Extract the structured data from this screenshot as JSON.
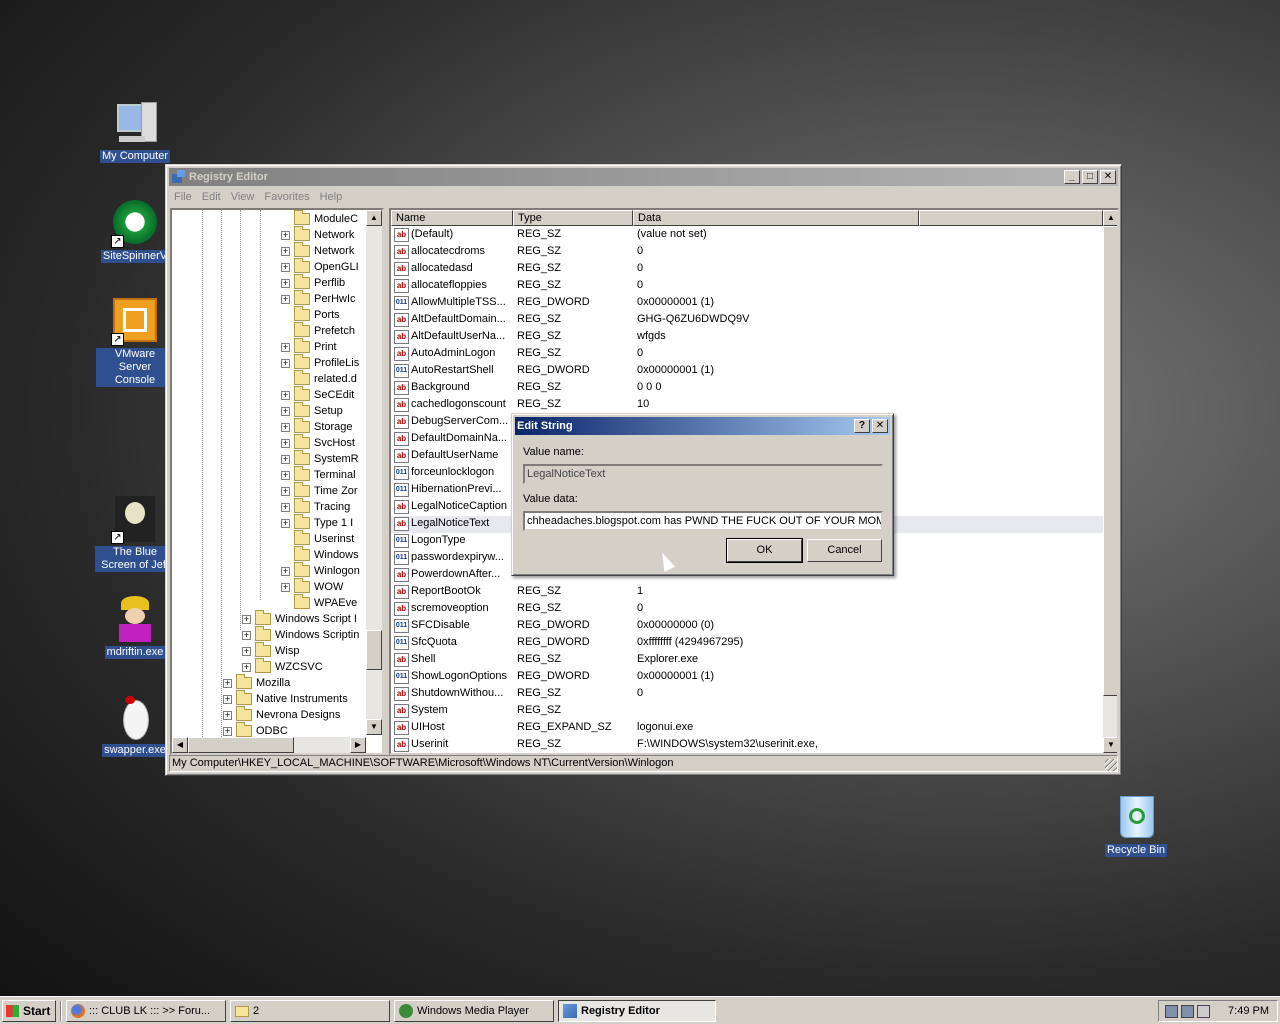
{
  "desktop": {
    "icons": [
      {
        "label": "My Computer",
        "icon": "computer-icon"
      },
      {
        "label": "SiteSpinnerV",
        "icon": "sitespinner-icon"
      },
      {
        "label": "VMware Server Console",
        "icon": "vmware-icon"
      },
      {
        "label": "The Blue Screen of Jeff",
        "icon": "skull-icon"
      },
      {
        "label": "mdriftin.exe",
        "icon": "jester-icon"
      },
      {
        "label": "swapper.exe",
        "icon": "mouse-icon"
      },
      {
        "label": "Recycle Bin",
        "icon": "recycle-bin-icon"
      }
    ]
  },
  "window": {
    "title": "Registry Editor",
    "menu": [
      "File",
      "Edit",
      "View",
      "Favorites",
      "Help"
    ],
    "tree": [
      {
        "label": "ModuleC",
        "expander": "",
        "level": 3
      },
      {
        "label": "Network",
        "expander": "+",
        "level": 3
      },
      {
        "label": "Network",
        "expander": "+",
        "level": 3
      },
      {
        "label": "OpenGLI",
        "expander": "+",
        "level": 3
      },
      {
        "label": "Perflib",
        "expander": "+",
        "level": 3
      },
      {
        "label": "PerHwIc",
        "expander": "+",
        "level": 3
      },
      {
        "label": "Ports",
        "expander": "",
        "level": 3
      },
      {
        "label": "Prefetch",
        "expander": "",
        "level": 3
      },
      {
        "label": "Print",
        "expander": "+",
        "level": 3
      },
      {
        "label": "ProfileLis",
        "expander": "+",
        "level": 3
      },
      {
        "label": "related.d",
        "expander": "",
        "level": 3
      },
      {
        "label": "SeCEdit",
        "expander": "+",
        "level": 3
      },
      {
        "label": "Setup",
        "expander": "+",
        "level": 3
      },
      {
        "label": "Storage",
        "expander": "+",
        "level": 3
      },
      {
        "label": "SvcHost",
        "expander": "+",
        "level": 3
      },
      {
        "label": "SystemR",
        "expander": "+",
        "level": 3
      },
      {
        "label": "Terminal",
        "expander": "+",
        "level": 3
      },
      {
        "label": "Time Zor",
        "expander": "+",
        "level": 3
      },
      {
        "label": "Tracing",
        "expander": "+",
        "level": 3
      },
      {
        "label": "Type 1 I",
        "expander": "+",
        "level": 3
      },
      {
        "label": "Userinst",
        "expander": "",
        "level": 3
      },
      {
        "label": "Windows",
        "expander": "",
        "level": 3
      },
      {
        "label": "Winlogon",
        "expander": "+",
        "level": 3
      },
      {
        "label": "WOW",
        "expander": "+",
        "level": 3
      },
      {
        "label": "WPAEve",
        "expander": "",
        "level": 3
      },
      {
        "label": "Windows Script I",
        "expander": "+",
        "level": 2
      },
      {
        "label": "Windows Scriptin",
        "expander": "+",
        "level": 2
      },
      {
        "label": "Wisp",
        "expander": "+",
        "level": 2
      },
      {
        "label": "WZCSVC",
        "expander": "+",
        "level": 2
      },
      {
        "label": "Mozilla",
        "expander": "+",
        "level": 1
      },
      {
        "label": "Native Instruments",
        "expander": "+",
        "level": 1
      },
      {
        "label": "Nevrona Designs",
        "expander": "+",
        "level": 1
      },
      {
        "label": "ODBC",
        "expander": "+",
        "level": 1
      }
    ],
    "columns": [
      "Name",
      "Type",
      "Data"
    ],
    "values": [
      {
        "name": "(Default)",
        "type": "REG_SZ",
        "data": "(value not set)",
        "kind": "ab"
      },
      {
        "name": "allocatecdroms",
        "type": "REG_SZ",
        "data": "0",
        "kind": "ab"
      },
      {
        "name": "allocatedasd",
        "type": "REG_SZ",
        "data": "0",
        "kind": "ab"
      },
      {
        "name": "allocatefloppies",
        "type": "REG_SZ",
        "data": "0",
        "kind": "ab"
      },
      {
        "name": "AllowMultipleTSS...",
        "type": "REG_DWORD",
        "data": "0x00000001 (1)",
        "kind": "bin"
      },
      {
        "name": "AltDefaultDomain...",
        "type": "REG_SZ",
        "data": "GHG-Q6ZU6DWDQ9V",
        "kind": "ab"
      },
      {
        "name": "AltDefaultUserNa...",
        "type": "REG_SZ",
        "data": "wfgds",
        "kind": "ab"
      },
      {
        "name": "AutoAdminLogon",
        "type": "REG_SZ",
        "data": "0",
        "kind": "ab"
      },
      {
        "name": "AutoRestartShell",
        "type": "REG_DWORD",
        "data": "0x00000001 (1)",
        "kind": "bin"
      },
      {
        "name": "Background",
        "type": "REG_SZ",
        "data": "0 0 0",
        "kind": "ab"
      },
      {
        "name": "cachedlogonscount",
        "type": "REG_SZ",
        "data": "10",
        "kind": "ab"
      },
      {
        "name": "DebugServerCom...",
        "type": "",
        "data": "",
        "kind": "ab"
      },
      {
        "name": "DefaultDomainNa...",
        "type": "",
        "data": "",
        "kind": "ab"
      },
      {
        "name": "DefaultUserName",
        "type": "",
        "data": "",
        "kind": "ab"
      },
      {
        "name": "forceunlocklogon",
        "type": "",
        "data": "",
        "kind": "bin"
      },
      {
        "name": "HibernationPrevi...",
        "type": "",
        "data": "",
        "kind": "bin"
      },
      {
        "name": "LegalNoticeCaption",
        "type": "",
        "data": "",
        "kind": "ab"
      },
      {
        "name": "LegalNoticeText",
        "type": "",
        "data": "",
        "kind": "ab"
      },
      {
        "name": "LogonType",
        "type": "",
        "data": "",
        "kind": "bin"
      },
      {
        "name": "passwordexpiryw...",
        "type": "",
        "data": "",
        "kind": "bin"
      },
      {
        "name": "PowerdownAfter...",
        "type": "",
        "data": "",
        "kind": "ab"
      },
      {
        "name": "ReportBootOk",
        "type": "REG_SZ",
        "data": "1",
        "kind": "ab"
      },
      {
        "name": "scremoveoption",
        "type": "REG_SZ",
        "data": "0",
        "kind": "ab"
      },
      {
        "name": "SFCDisable",
        "type": "REG_DWORD",
        "data": "0x00000000 (0)",
        "kind": "bin"
      },
      {
        "name": "SfcQuota",
        "type": "REG_DWORD",
        "data": "0xffffffff (4294967295)",
        "kind": "bin"
      },
      {
        "name": "Shell",
        "type": "REG_SZ",
        "data": "Explorer.exe",
        "kind": "ab"
      },
      {
        "name": "ShowLogonOptions",
        "type": "REG_DWORD",
        "data": "0x00000001 (1)",
        "kind": "bin"
      },
      {
        "name": "ShutdownWithou...",
        "type": "REG_SZ",
        "data": "0",
        "kind": "ab"
      },
      {
        "name": "System",
        "type": "REG_SZ",
        "data": "",
        "kind": "ab"
      },
      {
        "name": "UIHost",
        "type": "REG_EXPAND_SZ",
        "data": "logonui.exe",
        "kind": "ab"
      },
      {
        "name": "Userinit",
        "type": "REG_SZ",
        "data": "F:\\WINDOWS\\system32\\userinit.exe,",
        "kind": "ab"
      }
    ],
    "status": "My Computer\\HKEY_LOCAL_MACHINE\\SOFTWARE\\Microsoft\\Windows NT\\CurrentVersion\\Winlogon"
  },
  "dialog": {
    "title": "Edit String",
    "help_label": "?",
    "close_label": "✕",
    "value_name_label": "Value name:",
    "value_name": "LegalNoticeText",
    "value_data_label": "Value data:",
    "value_data": "chheadaches.blogspot.com has PWND THE FUCK OUT OF YOUR MOM",
    "ok_label": "OK",
    "cancel_label": "Cancel"
  },
  "taskbar": {
    "start_label": "Start",
    "tasks": [
      {
        "label": "::: CLUB LK ::: >> Foru...",
        "icon": "firefox-icon",
        "active": false
      },
      {
        "label": "2",
        "icon": "folder-icon",
        "active": false
      },
      {
        "label": "Windows Media Player",
        "icon": "media-player-icon",
        "active": false
      },
      {
        "label": "Registry Editor",
        "icon": "regedit-icon",
        "active": true
      }
    ],
    "clock": "7:49 PM"
  }
}
